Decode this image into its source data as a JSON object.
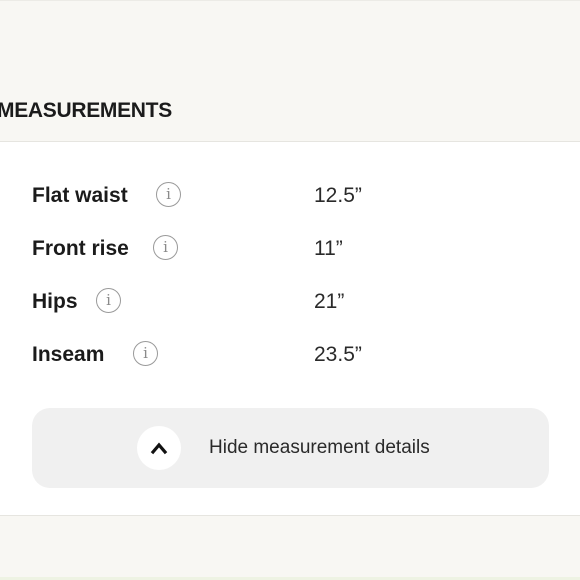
{
  "section": {
    "title": "MEASUREMENTS"
  },
  "measurements": [
    {
      "label": "Flat waist",
      "value": "12.5”"
    },
    {
      "label": "Front rise",
      "value": "11”"
    },
    {
      "label": "Hips",
      "value": "21”"
    },
    {
      "label": "Inseam",
      "value": "23.5”"
    }
  ],
  "info_icon": {
    "name": "info-icon",
    "glyph": "i"
  },
  "toggle": {
    "label": "Hide measurement details",
    "icon": "chevron-up-icon"
  }
}
